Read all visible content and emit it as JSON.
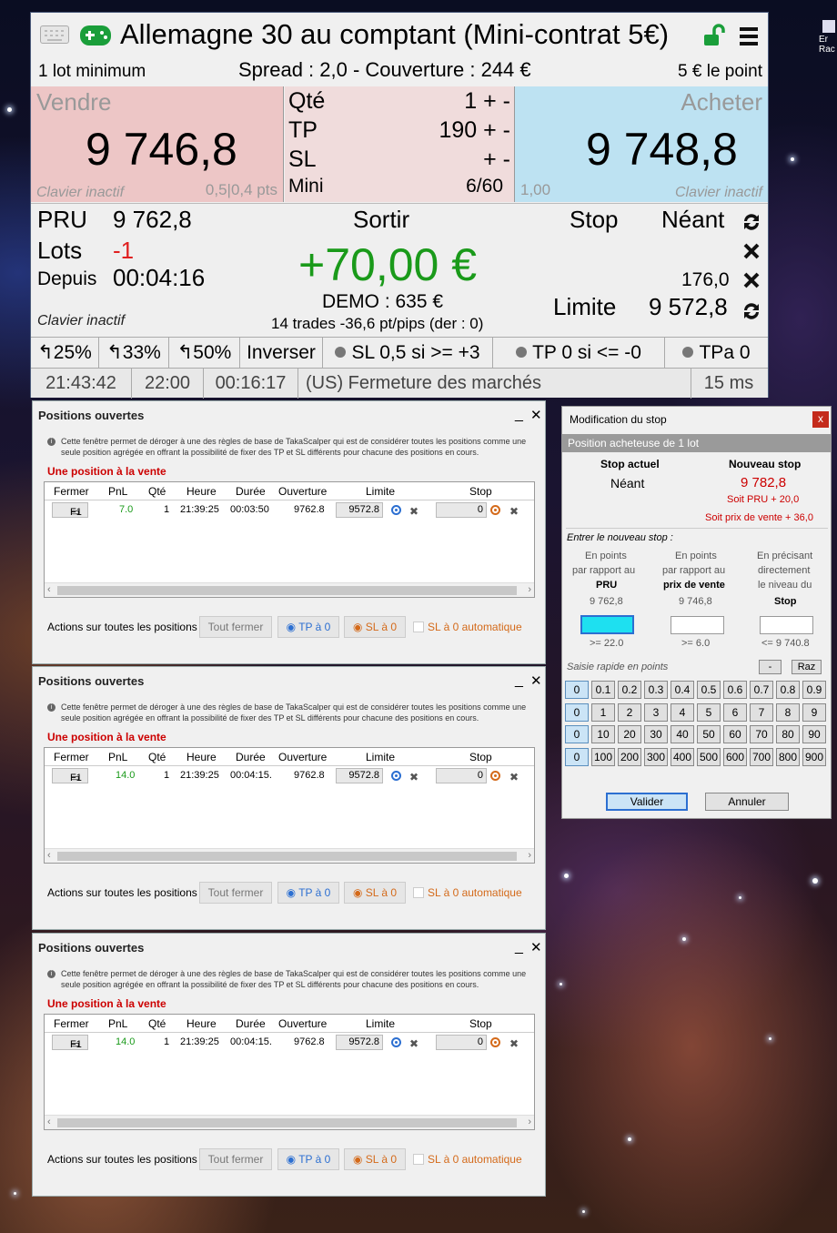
{
  "desktop": {
    "icon_label_1": "Er",
    "icon_label_2": "Rac"
  },
  "main": {
    "title": "Allemagne 30 au comptant (Mini-contrat 5€)",
    "lot_min": "1 lot minimum",
    "spread": "Spread : 2,0 - Couverture : 244 €",
    "point_value": "5 € le point",
    "sell": {
      "label": "Vendre",
      "price": "9 746,8",
      "status": "Clavier inactif",
      "info": "0,5|0,4 pts"
    },
    "buy": {
      "label": "Acheter",
      "price": "9 748,8",
      "status": "Clavier inactif",
      "info": "1,00"
    },
    "qty": {
      "label": "Qté",
      "value": "1",
      "ctrl": "+ -"
    },
    "tp": {
      "label": "TP",
      "value": "190",
      "ctrl": "+ -"
    },
    "sl": {
      "label": "SL",
      "value": "",
      "ctrl": "+ -"
    },
    "mini": {
      "label": "Mini",
      "value": "6/60"
    },
    "position": {
      "pru_label": "PRU",
      "pru_value": "9 762,8",
      "lots_label": "Lots",
      "lots_value": "-1",
      "since_label": "Depuis",
      "since_value": "00:04:16",
      "exit_label": "Sortir",
      "pnl": "+70,00 €",
      "demo": "DEMO : 635 €",
      "trades": "14 trades -36,6 pt/pips (der : 0)",
      "status": "Clavier inactif",
      "stop_label": "Stop",
      "stop_value": "Néant",
      "stop_dist": "176,0",
      "limit_label": "Limite",
      "limit_value": "9 572,8"
    },
    "buttons": [
      "25%",
      "33%",
      "50%",
      "Inverser",
      "SL 0,5 si >= +3",
      "TP 0 si <= -0",
      "TPa 0"
    ],
    "status_bar": [
      "21:43:42",
      "22:00",
      "00:16:17",
      "(US)  Fermeture des marchés",
      "15 ms"
    ]
  },
  "positions_window": {
    "title": "Positions ouvertes",
    "minimize": "_",
    "close": "✕",
    "info": "Cette fenêtre permet de déroger à une des règles de base de TakaScalper qui est de considérer toutes les positions comme une seule position agrégée en offrant la possibilité de fixer des TP et SL différents pour chacune des positions en cours.",
    "section": "Une position à la vente",
    "columns": [
      "Fermer",
      "PnL",
      "Qté",
      "Heure",
      "Durée",
      "Ouverture",
      "Limite",
      "Stop"
    ],
    "footer_label": "Actions sur toutes les positions :",
    "btn_close_all": "Tout fermer",
    "btn_tp0": "TP à 0",
    "btn_sl0": "SL à 0",
    "auto_sl": "SL à 0 automatique",
    "windows": [
      {
        "close_btn": "F1",
        "pnl": "7.0",
        "qty": "1",
        "time": "21:39:25",
        "duration": "00:03:50",
        "open": "9762.8",
        "limit": "9572.8",
        "stop": "0"
      },
      {
        "close_btn": "F1",
        "pnl": "14.0",
        "qty": "1",
        "time": "21:39:25",
        "duration": "00:04:15.",
        "open": "9762.8",
        "limit": "9572.8",
        "stop": "0"
      },
      {
        "close_btn": "F1",
        "pnl": "14.0",
        "qty": "1",
        "time": "21:39:25",
        "duration": "00:04:15.",
        "open": "9762.8",
        "limit": "9572.8",
        "stop": "0"
      }
    ]
  },
  "stop_dialog": {
    "title": "Modification du stop",
    "close": "x",
    "subtitle": "Position acheteuse de 1 lot",
    "current_label": "Stop actuel",
    "current_value": "Néant",
    "new_label": "Nouveau stop",
    "new_value": "9 782,8",
    "new_pru": "Soit PRU + 20,0",
    "new_sell": "Soit prix de vente + 36,0",
    "enter_label": "Entrer le nouveau stop :",
    "col1": {
      "l1": "En points",
      "l2": "par rapport au",
      "l3": "PRU",
      "ref": "9 762,8",
      "constraint": ">= 22.0"
    },
    "col2": {
      "l1": "En points",
      "l2": "par rapport au",
      "l3": "prix de vente",
      "ref": "9 746,8",
      "constraint": ">= 6.0"
    },
    "col3": {
      "l1": "En précisant",
      "l2": "directement",
      "l3": "le niveau du",
      "l4": "Stop",
      "constraint": "<= 9 740.8"
    },
    "quick_label": "Saisie rapide en points",
    "minus": "-",
    "reset": "Raz",
    "keys": [
      [
        "0",
        "0.1",
        "0.2",
        "0.3",
        "0.4",
        "0.5",
        "0.6",
        "0.7",
        "0.8",
        "0.9"
      ],
      [
        "0",
        "1",
        "2",
        "3",
        "4",
        "5",
        "6",
        "7",
        "8",
        "9"
      ],
      [
        "0",
        "10",
        "20",
        "30",
        "40",
        "50",
        "60",
        "70",
        "80",
        "90"
      ],
      [
        "0",
        "100",
        "200",
        "300",
        "400",
        "500",
        "600",
        "700",
        "800",
        "900"
      ]
    ],
    "ok": "Valider",
    "cancel": "Annuler"
  }
}
